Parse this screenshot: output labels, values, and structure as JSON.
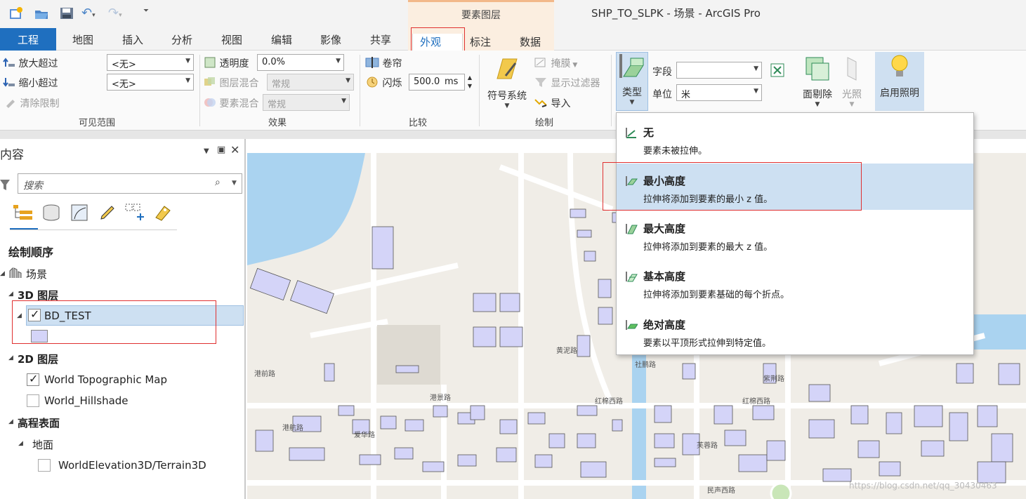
{
  "window": {
    "title": "SHP_TO_SLPK - 场景 - ArcGIS Pro"
  },
  "contextual_tab_group": "要素图层",
  "tabs": [
    "工程",
    "地图",
    "插入",
    "分析",
    "视图",
    "编辑",
    "影像",
    "共享",
    "外观",
    "标注",
    "数据"
  ],
  "ribbon": {
    "visible_range": {
      "zoom_in_label": "放大超过",
      "zoom_out_label": "缩小超过",
      "clear_label": "清除限制",
      "zoom_in_value": "<无>",
      "zoom_out_value": "<无>",
      "group_label": "可见范围"
    },
    "effects": {
      "transparency_label": "透明度",
      "transparency_value": "0.0%",
      "layer_blend_label": "图层混合",
      "layer_blend_value": "常规",
      "feature_blend_label": "要素混合",
      "feature_blend_value": "常规",
      "group_label": "效果"
    },
    "compare": {
      "swipe_label": "卷帘",
      "flicker_label": "闪烁",
      "flicker_value": "500.0",
      "flicker_unit": "ms",
      "group_label": "比较"
    },
    "drawing": {
      "symbology_label": "符号系统",
      "mask_label": "掩膜",
      "display_filter_label": "显示过滤器",
      "import_label": "导入",
      "group_label": "绘制"
    },
    "extrusion": {
      "type_label": "类型",
      "field_label": "字段",
      "field_value": "",
      "unit_label": "单位",
      "unit_value": "米"
    },
    "face_culling_label": "面剔除",
    "lighting_label": "光照",
    "enable_lighting_label": "启用照明"
  },
  "extrusion_menu": [
    {
      "title": "无",
      "desc": "要素未被拉伸。"
    },
    {
      "title": "最小高度",
      "desc": "拉伸将添加到要素的最小 z 值。"
    },
    {
      "title": "最大高度",
      "desc": "拉伸将添加到要素的最大 z 值。"
    },
    {
      "title": "基本高度",
      "desc": "拉伸将添加到要素基础的每个折点。"
    },
    {
      "title": "绝对高度",
      "desc": "要素以平顶形式拉伸到特定值。"
    }
  ],
  "contents": {
    "title": "内容",
    "search_placeholder": "搜索",
    "drawing_order_label": "绘制顺序",
    "scene_label": "场景",
    "group_3d": "3D 图层",
    "layer_bd_test": "BD_TEST",
    "group_2d": "2D 图层",
    "layer_topo": "World Topographic Map",
    "layer_hillshade": "World_Hillshade",
    "group_elev": "高程表面",
    "ground_label": "地面",
    "elev_layer": "WorldElevation3D/Terrain3D"
  },
  "map": {
    "road_labels": [
      "港景路",
      "红棉西路",
      "红棉西路",
      "港前路",
      "紫荆路",
      "社鹏路",
      "黄泥路",
      "港航路",
      "爱华路",
      "芙蓉路",
      "民声西路"
    ],
    "watermark": "https://blog.csdn.net/qq_30430463"
  },
  "colors": {
    "accent": "#1f6fbf",
    "selected_row": "#cde0f2",
    "building_fill": "#d4d4f8",
    "water": "#aad3f0",
    "highlight_box": "#e03030"
  }
}
